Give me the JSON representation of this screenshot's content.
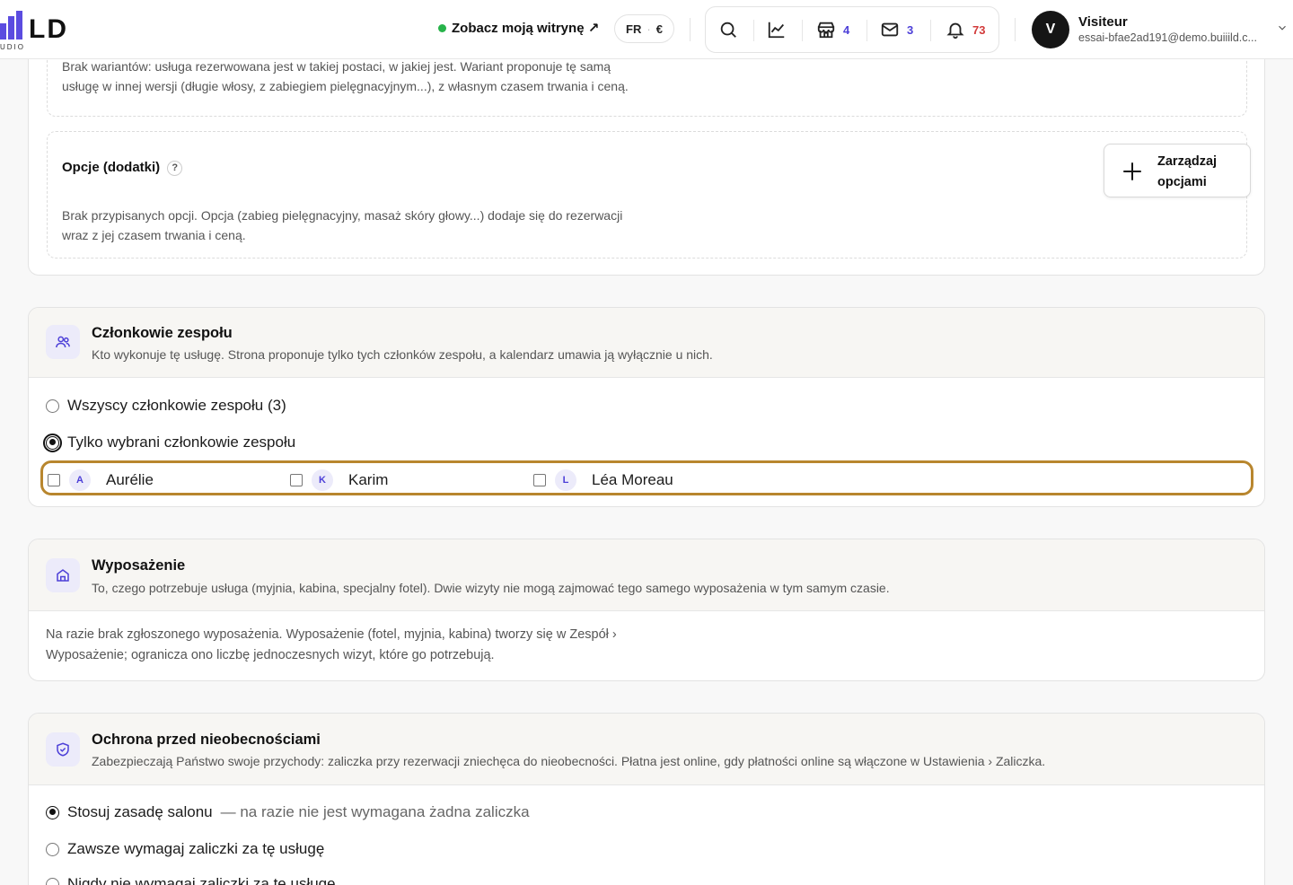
{
  "header": {
    "logo_text": "LD",
    "logo_sub": "UDIO",
    "site_link": "Zobacz moją witrynę ↗",
    "lang": "FR",
    "currency": "€",
    "tools": {
      "shop_count": "4",
      "mail_count": "3",
      "bell_count": "73"
    },
    "user": {
      "initial": "V",
      "name": "Visiteur",
      "email": "essai-bfae2ad191@demo.buiiild.c..."
    }
  },
  "variants": {
    "text_line1": "Brak wariantów: usługa rezerwowana jest w takiej postaci, w jakiej jest. Wariant proponuje tę samą",
    "text_line2": "usługę w innej wersji (długie włosy, z zabiegiem pielęgnacyjnym...), z własnym czasem trwania i ceną."
  },
  "options": {
    "title": "Opcje (dodatki)",
    "help": "?",
    "manage_button": "Zarządzaj opcjami",
    "text_line1": "Brak przypisanych opcji. Opcja (zabieg pielęgnacyjny, masaż skóry głowy...) dodaje się do rezerwacji",
    "text_line2": "wraz z jej czasem trwania i ceną."
  },
  "team": {
    "title": "Członkowie zespołu",
    "description": "Kto wykonuje tę usługę. Strona proponuje tylko tych członków zespołu, a kalendarz umawia ją wyłącznie u nich.",
    "radio_all": "Wszyscy członkowie zespołu (3)",
    "radio_selected": "Tylko wybrani członkowie zespołu",
    "members": [
      {
        "initial": "A",
        "name": "Aurélie"
      },
      {
        "initial": "K",
        "name": "Karim"
      },
      {
        "initial": "L",
        "name": "Léa Moreau"
      }
    ]
  },
  "equipment": {
    "title": "Wyposażenie",
    "description": "To, czego potrzebuje usługa (myjnia, kabina, specjalny fotel). Dwie wizyty nie mogą zajmować tego samego wyposażenia w tym samym czasie.",
    "text_line1": "Na razie brak zgłoszonego wyposażenia. Wyposażenie (fotel, myjnia, kabina) tworzy się w Zespół ›",
    "text_line2": "Wyposażenie; ogranicza ono liczbę jednoczesnych wizyt, które go potrzebują."
  },
  "noshow": {
    "title": "Ochrona przed nieobecnościami",
    "description": "Zabezpieczają Państwo swoje przychody: zaliczka przy rezerwacji zniechęca do nieobecności. Płatna jest online, gdy płatności online są włączone w Ustawienia › Zaliczka.",
    "radio_salon": "Stosuj zasadę salonu",
    "radio_salon_suffix": "— na razie nie jest wymagana żadna zaliczka",
    "radio_always": "Zawsze wymagaj zaliczki za tę usługę",
    "radio_never": "Nigdy nie wymagaj zaliczki za tę usługę"
  }
}
